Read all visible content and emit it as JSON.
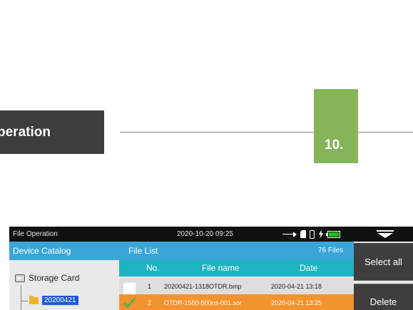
{
  "page": {
    "section_title": "peration",
    "chapter_number": "10."
  },
  "device": {
    "status_bar": {
      "title": "File Operation",
      "datetime": "2020-10-20 09:25",
      "icons": [
        "usb-icon",
        "sd-card-icon",
        "probe-icon",
        "charging-icon",
        "battery-icon",
        "dropdown-icon"
      ]
    },
    "catalog": {
      "header": "Device Catalog",
      "root_label": "Storage Card",
      "folder_label": "20200421"
    },
    "file_list": {
      "header": "File List",
      "count_label": "76 Files",
      "columns": [
        "No.",
        "File name",
        "Date"
      ],
      "rows": [
        {
          "no": "1",
          "name": "20200421-1318OTDR.bmp",
          "date": "2020-04-21 13:18",
          "checked": false
        },
        {
          "no": "2",
          "name": "OTDR-1550-500ns-001.sor",
          "date": "2020-04-21 13:25",
          "checked": true
        }
      ]
    },
    "buttons": {
      "select_all": "Select all",
      "delete": "Delete"
    },
    "colors": {
      "panel_header": "#3aa6d8",
      "column_header": "#1fb3c3",
      "selected_row": "#f4922e",
      "chapter_box": "#86b45a",
      "section_tab": "#3d3d3d"
    }
  }
}
